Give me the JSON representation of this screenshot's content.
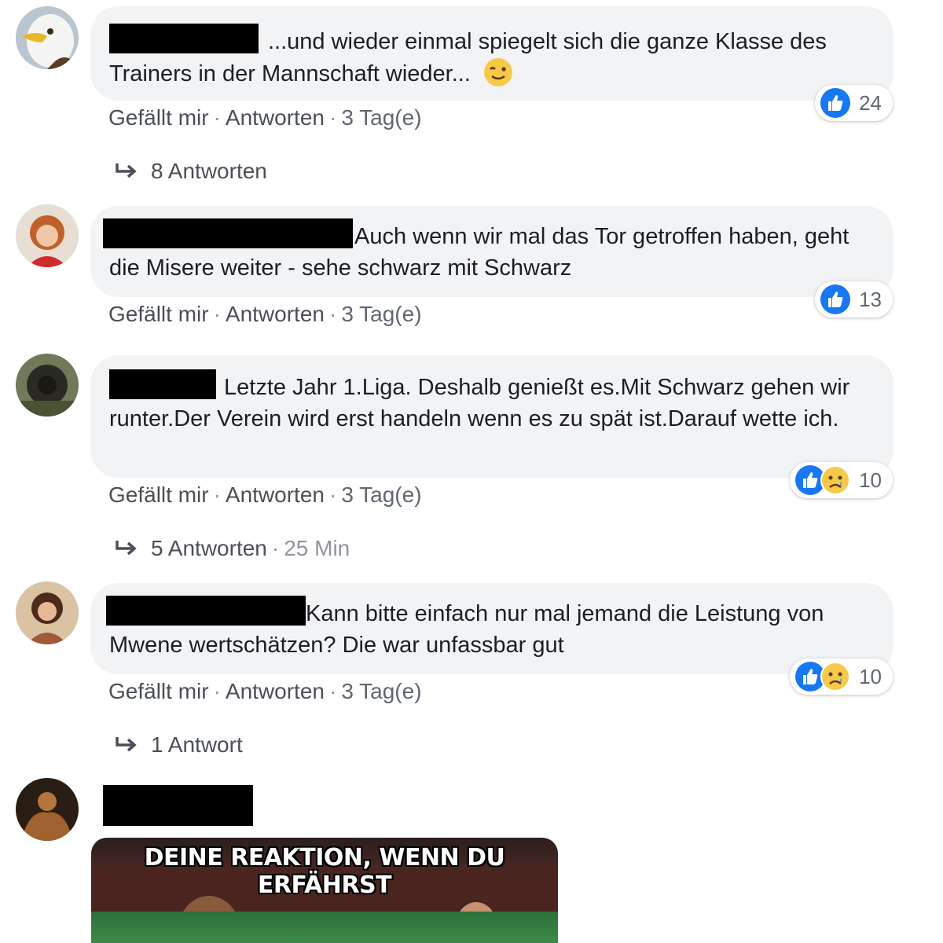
{
  "comments": [
    {
      "text": "...und wieder einmal spiegelt sich die ganze Klasse des Trainers in der Mannschaft wieder...",
      "emoji": "wink-emoji",
      "actions": {
        "like": "Gefällt mir",
        "reply": "Antworten",
        "time": "3 Tag(e)"
      },
      "reactions": {
        "icons": [
          "like-icon"
        ],
        "count": "24"
      },
      "replies": {
        "label": "8 Antworten",
        "time": ""
      }
    },
    {
      "text": "Auch wenn wir mal das Tor getroffen haben, geht die Misere weiter - sehe schwarz mit Schwarz",
      "actions": {
        "like": "Gefällt mir",
        "reply": "Antworten",
        "time": "3 Tag(e)"
      },
      "reactions": {
        "icons": [
          "like-icon"
        ],
        "count": "13"
      }
    },
    {
      "text": "Letzte Jahr 1.Liga. Deshalb genießt es.Mit Schwarz gehen wir runter.Der Verein wird erst handeln wenn es zu spät ist.Darauf wette ich.",
      "actions": {
        "like": "Gefällt mir",
        "reply": "Antworten",
        "time": "3 Tag(e)"
      },
      "reactions": {
        "icons": [
          "like-icon",
          "sad-icon"
        ],
        "count": "10"
      },
      "replies": {
        "label": "5 Antworten",
        "time": "25 Min"
      }
    },
    {
      "text": "Kann bitte einfach nur mal jemand die Leistung von Mwene wertschätzen? Die war unfassbar gut",
      "actions": {
        "like": "Gefällt mir",
        "reply": "Antworten",
        "time": "3 Tag(e)"
      },
      "reactions": {
        "icons": [
          "like-icon",
          "sad-icon"
        ],
        "count": "10"
      },
      "replies": {
        "label": "1 Antwort",
        "time": ""
      }
    }
  ],
  "meme": {
    "caption": "DEINE REAKTION, WENN DU ERFÄHRST"
  },
  "colors": {
    "bubble": "#f2f3f5",
    "like_blue": "#1877f2",
    "text": "#1c1e21",
    "meta": "#606770"
  }
}
